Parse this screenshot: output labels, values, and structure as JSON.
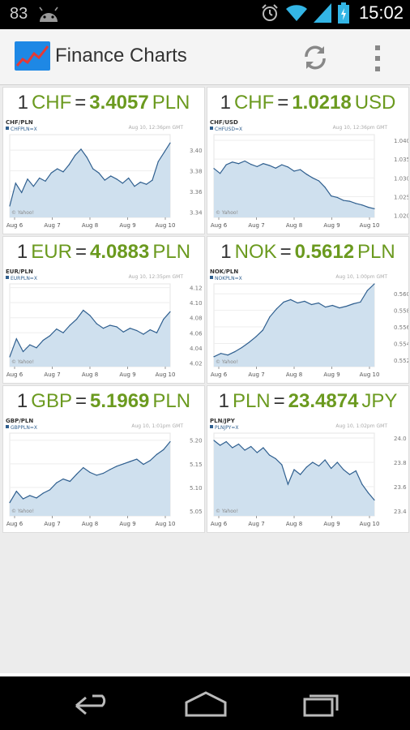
{
  "status_bar": {
    "battery_percent": "83",
    "time": "15:02"
  },
  "app": {
    "title": "Finance Charts"
  },
  "cards": [
    {
      "one": "1",
      "base": "CHF",
      "eq": "=",
      "rate": "3.4057",
      "quote": "PLN",
      "pair_label": "CHF/PLN",
      "legend": "CHFPLN=X",
      "timestamp": "Aug 10, 12:36pm GMT",
      "source": "© Yahoo!",
      "chart_data": {
        "type": "line",
        "x_ticks": [
          "Aug 6",
          "Aug 7",
          "Aug 8",
          "Aug 9",
          "Aug 10"
        ],
        "y_ticks": [
          "3.40",
          "3.38",
          "3.36",
          "3.34"
        ],
        "y_tick_values": [
          3.4,
          3.38,
          3.36,
          3.34
        ],
        "ylim": [
          3.335,
          3.415
        ],
        "values": [
          3.346,
          3.368,
          3.359,
          3.372,
          3.365,
          3.373,
          3.37,
          3.378,
          3.382,
          3.379,
          3.386,
          3.395,
          3.401,
          3.393,
          3.382,
          3.378,
          3.371,
          3.375,
          3.372,
          3.368,
          3.373,
          3.365,
          3.369,
          3.367,
          3.371,
          3.389,
          3.398,
          3.407
        ]
      }
    },
    {
      "one": "1",
      "base": "CHF",
      "eq": "=",
      "rate": "1.0218",
      "quote": "USD",
      "pair_label": "CHF/USD",
      "legend": "CHFUSD=X",
      "timestamp": "Aug 10, 12:36pm GMT",
      "source": "© Yahoo!",
      "chart_data": {
        "type": "line",
        "x_ticks": [
          "Aug 6",
          "Aug 7",
          "Aug 8",
          "Aug 9",
          "Aug 10"
        ],
        "y_ticks": [
          "1.040",
          "1.035",
          "1.030",
          "1.025",
          "1.020"
        ],
        "y_tick_values": [
          1.04,
          1.035,
          1.03,
          1.025,
          1.02
        ],
        "ylim": [
          1.0195,
          1.0415
        ],
        "values": [
          1.0325,
          1.0312,
          1.0335,
          1.0342,
          1.0338,
          1.0345,
          1.0336,
          1.033,
          1.0338,
          1.0333,
          1.0326,
          1.0335,
          1.0329,
          1.0318,
          1.0322,
          1.031,
          1.03,
          1.0292,
          1.0275,
          1.0252,
          1.0248,
          1.024,
          1.0238,
          1.0232,
          1.0228,
          1.0222,
          1.0218
        ]
      }
    },
    {
      "one": "1",
      "base": "EUR",
      "eq": "=",
      "rate": "4.0883",
      "quote": "PLN",
      "pair_label": "EUR/PLN",
      "legend": "EURPLN=X",
      "timestamp": "Aug 10, 12:35pm GMT",
      "source": "© Yahoo!",
      "chart_data": {
        "type": "line",
        "x_ticks": [
          "Aug 6",
          "Aug 7",
          "Aug 8",
          "Aug 9",
          "Aug 10"
        ],
        "y_ticks": [
          "4.12",
          "4.10",
          "4.08",
          "4.06",
          "4.04",
          "4.02"
        ],
        "y_tick_values": [
          4.12,
          4.1,
          4.08,
          4.06,
          4.04,
          4.02
        ],
        "ylim": [
          4.015,
          4.125
        ],
        "values": [
          4.028,
          4.052,
          4.035,
          4.044,
          4.04,
          4.05,
          4.056,
          4.065,
          4.06,
          4.07,
          4.078,
          4.09,
          4.083,
          4.072,
          4.066,
          4.07,
          4.068,
          4.061,
          4.066,
          4.063,
          4.058,
          4.064,
          4.06,
          4.078,
          4.088
        ]
      }
    },
    {
      "one": "1",
      "base": "NOK",
      "eq": "=",
      "rate": "0.5612",
      "quote": "PLN",
      "pair_label": "NOK/PLN",
      "legend": "NOKPLN=X",
      "timestamp": "Aug 10, 1:00pm GMT",
      "source": "© Yahoo!",
      "chart_data": {
        "type": "line",
        "x_ticks": [
          "Aug 6",
          "Aug 7",
          "Aug 8",
          "Aug 9",
          "Aug 10"
        ],
        "y_ticks": [
          "0.560",
          "0.558",
          "0.556",
          "0.554",
          "0.552"
        ],
        "y_tick_values": [
          0.56,
          0.558,
          0.556,
          0.554,
          0.552
        ],
        "ylim": [
          0.5512,
          0.5612
        ],
        "values": [
          0.5524,
          0.5528,
          0.5526,
          0.553,
          0.5535,
          0.5541,
          0.5548,
          0.5556,
          0.5572,
          0.5582,
          0.559,
          0.5593,
          0.5589,
          0.5591,
          0.5587,
          0.5589,
          0.5584,
          0.5586,
          0.5583,
          0.5585,
          0.5588,
          0.559,
          0.5604,
          0.5612
        ]
      }
    },
    {
      "one": "1",
      "base": "GBP",
      "eq": "=",
      "rate": "5.1969",
      "quote": "PLN",
      "pair_label": "GBP/PLN",
      "legend": "GBPPLN=X",
      "timestamp": "Aug 10, 1:01pm GMT",
      "source": "© Yahoo!",
      "chart_data": {
        "type": "line",
        "x_ticks": [
          "Aug 6",
          "Aug 7",
          "Aug 8",
          "Aug 9",
          "Aug 10"
        ],
        "y_ticks": [
          "5.20",
          "5.15",
          "5.10",
          "5.05"
        ],
        "y_tick_values": [
          5.2,
          5.15,
          5.1,
          5.05
        ],
        "ylim": [
          5.04,
          5.215
        ],
        "values": [
          5.068,
          5.092,
          5.076,
          5.083,
          5.078,
          5.088,
          5.095,
          5.11,
          5.118,
          5.113,
          5.128,
          5.142,
          5.132,
          5.126,
          5.13,
          5.138,
          5.145,
          5.15,
          5.155,
          5.16,
          5.149,
          5.157,
          5.17,
          5.18,
          5.197
        ]
      }
    },
    {
      "one": "1",
      "base": "PLN",
      "eq": "=",
      "rate": "23.4874",
      "quote": "JPY",
      "pair_label": "PLN/JPY",
      "legend": "PLNJPY=X",
      "timestamp": "Aug 10, 1:02pm GMT",
      "source": "© Yahoo!",
      "chart_data": {
        "type": "line",
        "x_ticks": [
          "Aug 6",
          "Aug 7",
          "Aug 8",
          "Aug 9",
          "Aug 10"
        ],
        "y_ticks": [
          "24.0",
          "23.8",
          "23.6",
          "23.4"
        ],
        "y_tick_values": [
          24.0,
          23.8,
          23.6,
          23.4
        ],
        "ylim": [
          23.36,
          24.04
        ],
        "values": [
          23.98,
          23.94,
          23.97,
          23.92,
          23.95,
          23.9,
          23.93,
          23.88,
          23.92,
          23.86,
          23.83,
          23.78,
          23.62,
          23.74,
          23.7,
          23.76,
          23.8,
          23.77,
          23.82,
          23.75,
          23.8,
          23.74,
          23.7,
          23.73,
          23.62,
          23.55,
          23.49
        ]
      }
    }
  ],
  "nav": {
    "back": "back-icon",
    "home": "home-icon",
    "recents": "recents-icon"
  }
}
